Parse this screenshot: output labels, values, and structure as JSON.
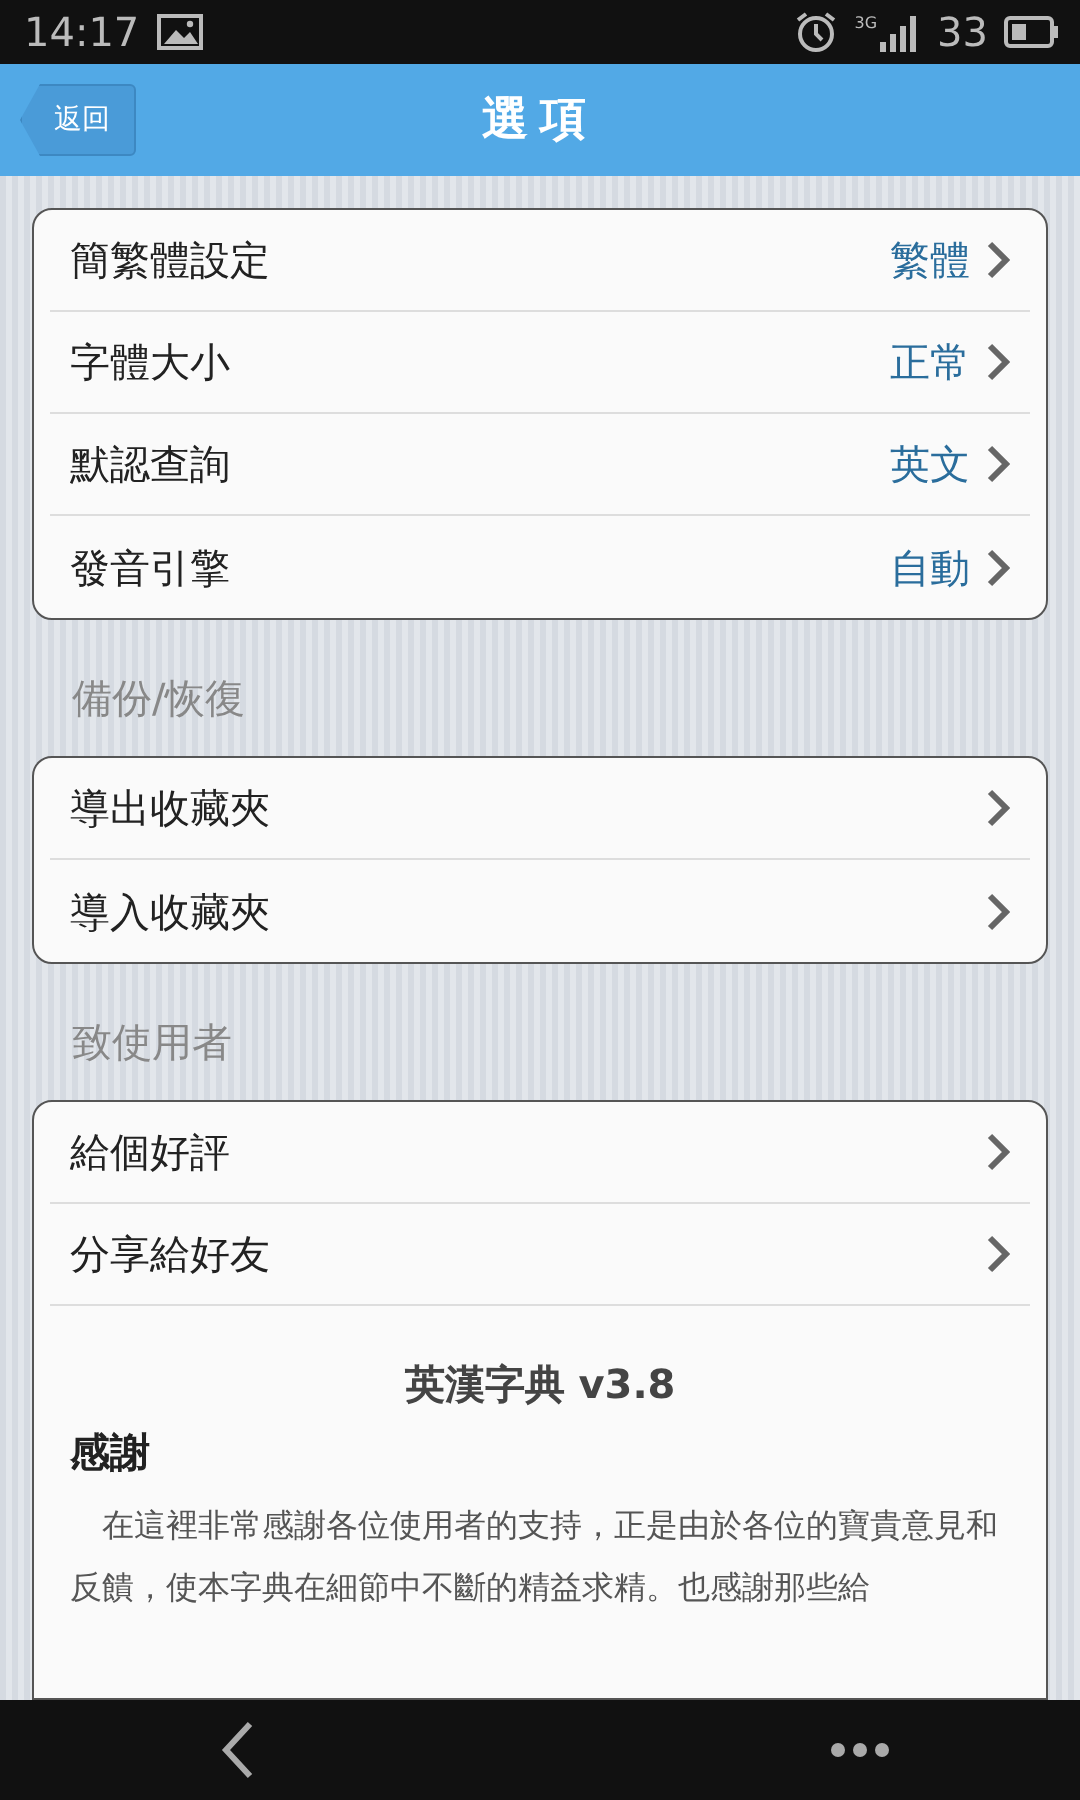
{
  "status_bar": {
    "time": "14:17",
    "network": "3G",
    "battery": "33"
  },
  "header": {
    "back": "返回",
    "title": "選項"
  },
  "groups": [
    {
      "items": [
        {
          "label": "簡繁體設定",
          "value": "繁體"
        },
        {
          "label": "字體大小",
          "value": "正常"
        },
        {
          "label": "默認查詢",
          "value": "英文"
        },
        {
          "label": "發音引擎",
          "value": "自動"
        }
      ]
    },
    {
      "heading": "備份/恢復",
      "items": [
        {
          "label": "導出收藏夾"
        },
        {
          "label": "導入收藏夾"
        }
      ]
    },
    {
      "heading": "致使用者",
      "items": [
        {
          "label": "給個好評"
        },
        {
          "label": "分享給好友"
        }
      ],
      "about": {
        "title": "英漢字典 v3.8",
        "subtitle": "感謝",
        "text": "在這裡非常感謝各位使用者的支持，正是由於各位的寶貴意見和反饋，使本字典在細節中不斷的精益求精。也感謝那些給"
      }
    }
  ]
}
